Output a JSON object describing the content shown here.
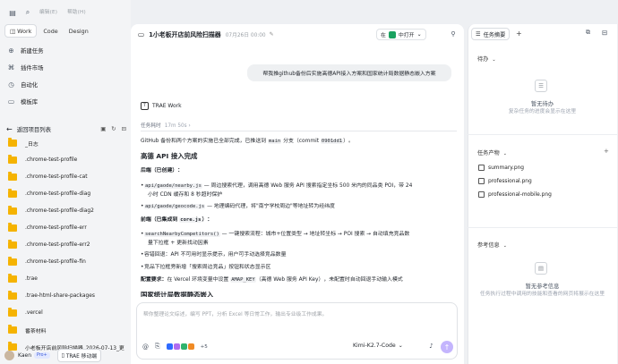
{
  "topbar": {
    "menu": [
      "编辑(E)",
      "帮助(H)"
    ]
  },
  "sidebar": {
    "mode_tabs": [
      "Work",
      "Code",
      "Design"
    ],
    "nav_items": [
      {
        "label": "新建任务",
        "icon": "new-task-icon"
      },
      {
        "label": "插件市场",
        "icon": "plugin-icon"
      },
      {
        "label": "自动化",
        "icon": "clock-icon"
      },
      {
        "label": "模板库",
        "icon": "template-icon"
      }
    ],
    "project_header": "返回项目列表",
    "folders": [
      "_日志",
      ".chrome-test-profile",
      ".chrome-test-profile-cat",
      ".chrome-test-profile-diag",
      ".chrome-test-profile-diag2",
      ".chrome-test-profile-err",
      ".chrome-test-profile-err2",
      ".chrome-test-profile-fin",
      ".trae",
      ".trae-html-share-packages",
      ".vercel",
      "番茶材料",
      "小老板开店前风险扫描器_2026-07-13_更"
    ],
    "user": {
      "name": "Kaen",
      "badge": "Pro+",
      "mobile_button": "TRAE 移动端"
    }
  },
  "chat": {
    "title": "1小老板开店前风险扫描器",
    "subtitle": "07月26日 00:00",
    "open_in_prefix": "在",
    "open_in_label": "中打开",
    "user_message": "帮我推github备份后实施高德API接入方案和国家统计局数据静态嵌入方案",
    "agent_name": "TRAE Work",
    "task_time_label": "任务耗时",
    "task_time_value": "17m 50s",
    "content": {
      "intro_pre": "GitHub 备份和两个方案的实施已全部完成，已推送到 ",
      "intro_branch": "main",
      "intro_mid": " 分支（commit ",
      "intro_commit": "0901dd1",
      "intro_post": "）。",
      "h_amap": "高德 API 接入完成",
      "h_backend": "后端（已创建）：",
      "b1_code": "api/gaode/nearby.js",
      "b1_text": " — 周边搜索代理，调用高德 Web 服务 API 搜索指定坐标 500 米内的同品类 POI，带 24",
      "b1_text2": "小时 CDN 缓存和 8 秒超时保护",
      "b2_code": "api/gaode/geocode.js",
      "b2_text": " — 地理编码代理，将\"南宁学校周边\"等地址转为经纬度",
      "h_frontend_pre": "前端（已集成到 ",
      "h_frontend_code": "core.js",
      "h_frontend_post": "）：",
      "f1_code": "searchNearbyCompetitors()",
      "f1_text": " — 一键搜索流程：城市+位置类型 → 地址转坐标 → POI 搜索 → 自动填充竞品数",
      "f1_text2": "量下拉框 + 更新找动因素",
      "f2_text": "容错回退：API 不可用时显示提示，用户可手动选择竞品数量",
      "f3_text": "竞品下拉框旁新增「搜索周边竞品」按钮和状态显示区",
      "config_bold": "配置要求：",
      "config_pre": "在 Vercel 环境变量中设置 ",
      "config_code": "AMAP_KEY",
      "config_post": "（高德 Web 服务 API Key），未配置时自动回退手动输入模式",
      "h_stats": "国家统计局数据静态嵌入"
    },
    "composer_placeholder": "帮你整理论文综述，编写 PPT，分析 Excel 等日常工作，输出专业级工作成果。",
    "composer_more": "+5",
    "model": "Kimi-K2.7-Code"
  },
  "right_panel": {
    "tab_label": "任务摘要",
    "todo_section": "待办",
    "todo_empty_title": "暂无待办",
    "todo_empty_desc": "复杂任务的进度会显示在这里",
    "outputs_section": "任务产物",
    "outputs": [
      "summary.png",
      "professional.png",
      "professional-mobile.png"
    ],
    "refs_section": "参考信息",
    "refs_empty_title": "暂无参考信息",
    "refs_empty_desc": "任务执行过程中调用的技能和查看的网页将展示在这里"
  },
  "colors": {
    "accent": "#c4b5fd",
    "folder": "#f5b301",
    "open_in_badge": "#1aa260"
  }
}
